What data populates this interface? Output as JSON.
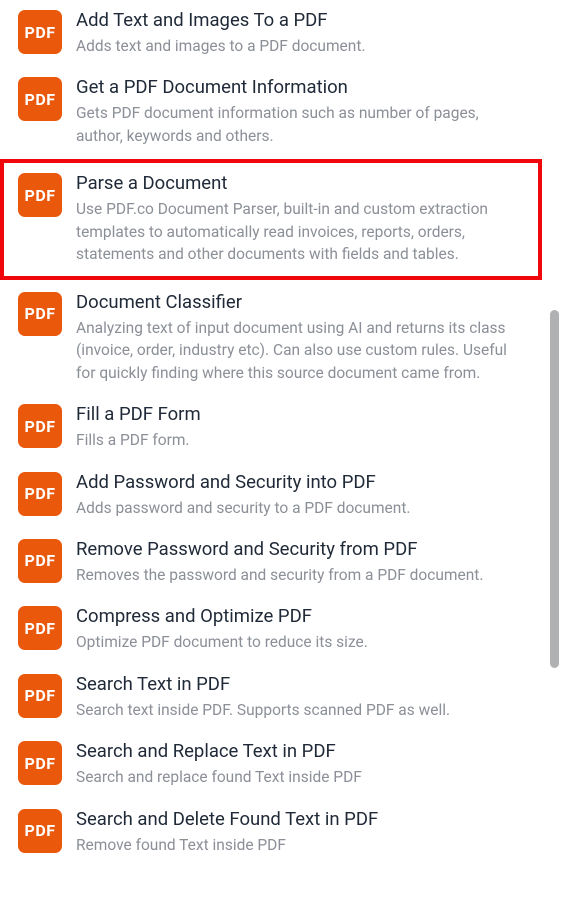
{
  "icon_label": "PDF",
  "highlighted_index": 2,
  "items": [
    {
      "title": "Add Text and Images To a PDF",
      "description": "Adds text and images to a PDF document."
    },
    {
      "title": "Get a PDF Document Information",
      "description": "Gets PDF document information such as number of pages, author, keywords and others."
    },
    {
      "title": "Parse a Document",
      "description": "Use PDF.co Document Parser, built-in and custom extraction templates to automatically read invoices, reports, orders, statements and other documents with fields and tables."
    },
    {
      "title": "Document Classifier",
      "description": "Analyzing text of input document using AI and returns its class (invoice, order, industry etc). Can also use custom rules. Useful for quickly finding where this source document came from."
    },
    {
      "title": "Fill a PDF Form",
      "description": "Fills a PDF form."
    },
    {
      "title": "Add Password and Security into PDF",
      "description": "Adds password and security to a PDF document."
    },
    {
      "title": "Remove Password and Security from PDF",
      "description": "Removes the password and security from a PDF document."
    },
    {
      "title": "Compress and Optimize PDF",
      "description": "Optimize PDF document to reduce its size."
    },
    {
      "title": "Search Text in PDF",
      "description": "Search text inside PDF. Supports scanned PDF as well."
    },
    {
      "title": "Search and Replace Text in PDF",
      "description": "Search and replace found Text inside PDF"
    },
    {
      "title": "Search and Delete Found Text in PDF",
      "description": "Remove found Text inside PDF"
    }
  ]
}
